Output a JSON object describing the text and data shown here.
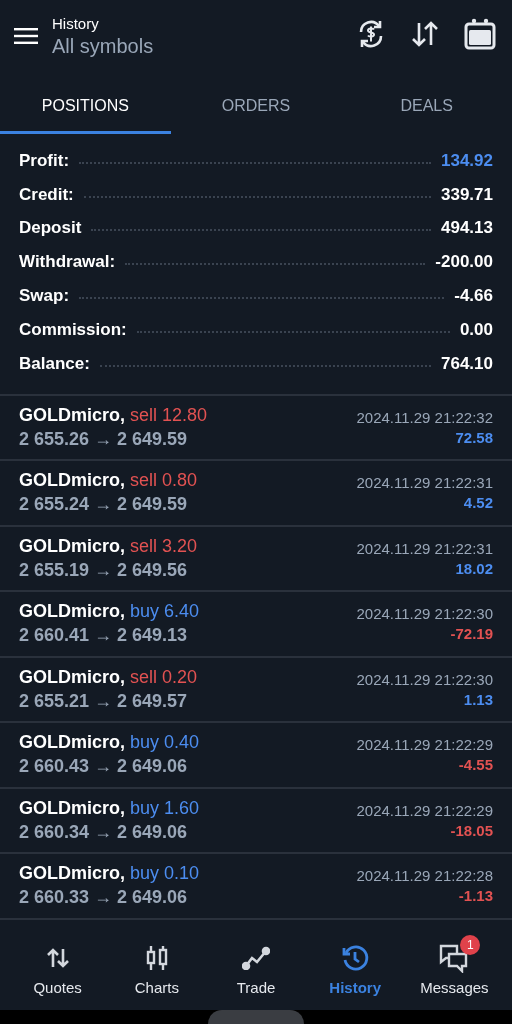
{
  "header": {
    "title": "History",
    "subtitle": "All symbols"
  },
  "tabs": [
    {
      "label": "POSITIONS",
      "selected": true
    },
    {
      "label": "ORDERS",
      "selected": false
    },
    {
      "label": "DEALS",
      "selected": false
    }
  ],
  "summary": [
    {
      "label": "Profit:",
      "value": "134.92",
      "highlight": true
    },
    {
      "label": "Credit:",
      "value": "339.71",
      "highlight": false
    },
    {
      "label": "Deposit",
      "value": "494.13",
      "highlight": false
    },
    {
      "label": "Withdrawal:",
      "value": "-200.00",
      "highlight": false
    },
    {
      "label": "Swap:",
      "value": "-4.66",
      "highlight": false
    },
    {
      "label": "Commission:",
      "value": "0.00",
      "highlight": false
    },
    {
      "label": "Balance:",
      "value": "764.10",
      "highlight": false
    }
  ],
  "positions": [
    {
      "symbol": "GOLDmicro,",
      "kind": "sell",
      "trade": "sell 12.80",
      "prices": "2 655.26 → 2 649.59",
      "time": "2024.11.29 21:22:32",
      "profit": "72.58",
      "loss": false
    },
    {
      "symbol": "GOLDmicro,",
      "kind": "sell",
      "trade": "sell 0.80",
      "prices": "2 655.24 → 2 649.59",
      "time": "2024.11.29 21:22:31",
      "profit": "4.52",
      "loss": false
    },
    {
      "symbol": "GOLDmicro,",
      "kind": "sell",
      "trade": "sell 3.20",
      "prices": "2 655.19 → 2 649.56",
      "time": "2024.11.29 21:22:31",
      "profit": "18.02",
      "loss": false
    },
    {
      "symbol": "GOLDmicro,",
      "kind": "buy",
      "trade": "buy 6.40",
      "prices": "2 660.41 → 2 649.13",
      "time": "2024.11.29 21:22:30",
      "profit": "-72.19",
      "loss": true
    },
    {
      "symbol": "GOLDmicro,",
      "kind": "sell",
      "trade": "sell 0.20",
      "prices": "2 655.21 → 2 649.57",
      "time": "2024.11.29 21:22:30",
      "profit": "1.13",
      "loss": false
    },
    {
      "symbol": "GOLDmicro,",
      "kind": "buy",
      "trade": "buy 0.40",
      "prices": "2 660.43 → 2 649.06",
      "time": "2024.11.29 21:22:29",
      "profit": "-4.55",
      "loss": true
    },
    {
      "symbol": "GOLDmicro,",
      "kind": "buy",
      "trade": "buy 1.60",
      "prices": "2 660.34 → 2 649.06",
      "time": "2024.11.29 21:22:29",
      "profit": "-18.05",
      "loss": true
    },
    {
      "symbol": "GOLDmicro,",
      "kind": "buy",
      "trade": "buy 0.10",
      "prices": "2 660.33 → 2 649.06",
      "time": "2024.11.29 21:22:28",
      "profit": "-1.13",
      "loss": true
    }
  ],
  "nav": [
    {
      "label": "Quotes",
      "kind": "quotes",
      "selected": false
    },
    {
      "label": "Charts",
      "kind": "charts",
      "selected": false
    },
    {
      "label": "Trade",
      "kind": "trade",
      "selected": false
    },
    {
      "label": "History",
      "kind": "history",
      "selected": true
    },
    {
      "label": "Messages",
      "kind": "messages",
      "selected": false,
      "badge": "1"
    }
  ]
}
